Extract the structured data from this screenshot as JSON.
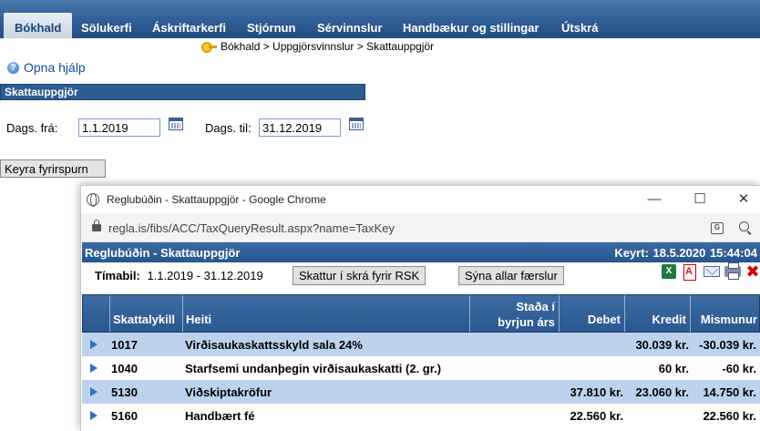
{
  "nav": {
    "items": [
      "Bókhald",
      "Sölukerfi",
      "Áskriftarkerfi",
      "Stjórnun",
      "Sérvinnslur",
      "Handbækur og stillingar",
      "Útskrá"
    ],
    "active_index": 0
  },
  "breadcrumb": "Bókhald > Uppgjörsvinnslur > Skattauppgjör",
  "help_link": "Opna hjálp",
  "section_title": "Skattauppgjör",
  "form": {
    "date_from_label": "Dags. frá:",
    "date_from_value": "1.1.2019",
    "date_to_label": "Dags. til:",
    "date_to_value": "31.12.2019",
    "run_button": "Keyra fyrirspurn"
  },
  "popup": {
    "window_title": "Reglubúðin - Skattauppgjör - Google Chrome",
    "url": "regla.is/fibs/ACC/TaxQueryResult.aspx?name=TaxKey",
    "window_buttons": {
      "minimize": "—",
      "maximize": "☐",
      "close": "✕"
    },
    "report_title": "Reglubúðin - Skattauppgjör",
    "report_run": "Keyrt:  18.5.2020 15:44:04",
    "period_label": "Tímabil:",
    "period_value": "1.1.2019 - 31.12.2019",
    "button_rsk": "Skattur í skrá fyrir RSK",
    "button_all": "Sýna allar færslur",
    "icons": [
      "excel-export-icon",
      "pdf-export-icon",
      "email-icon",
      "print-icon",
      "close-red-icon"
    ],
    "table": {
      "columns": {
        "key": "Skattalykill",
        "name": "Heiti",
        "opening_l1": "Staða í",
        "opening_l2": "byrjun árs",
        "debit": "Debet",
        "credit": "Kredit",
        "diff": "Mismunur"
      },
      "rows": [
        {
          "key": "1017",
          "name": "Virðisaukaskattsskyld sala 24%",
          "debit": "",
          "credit": "30.039 kr.",
          "diff": "-30.039 kr."
        },
        {
          "key": "1040",
          "name": "Starfsemi undanþegin virðisaukaskatti (2. gr.)",
          "debit": "",
          "credit": "60 kr.",
          "diff": "-60 kr."
        },
        {
          "key": "5130",
          "name": "Viðskiptakröfur",
          "debit": "37.810 kr.",
          "credit": "23.060 kr.",
          "diff": "14.750 kr."
        },
        {
          "key": "5160",
          "name": "Handbært fé",
          "debit": "22.560 kr.",
          "credit": "",
          "diff": "22.560 kr."
        }
      ]
    }
  },
  "colors": {
    "nav_blue": "#2d5b93",
    "row_alt": "#bdd3ec",
    "link": "#1a4aa0"
  }
}
